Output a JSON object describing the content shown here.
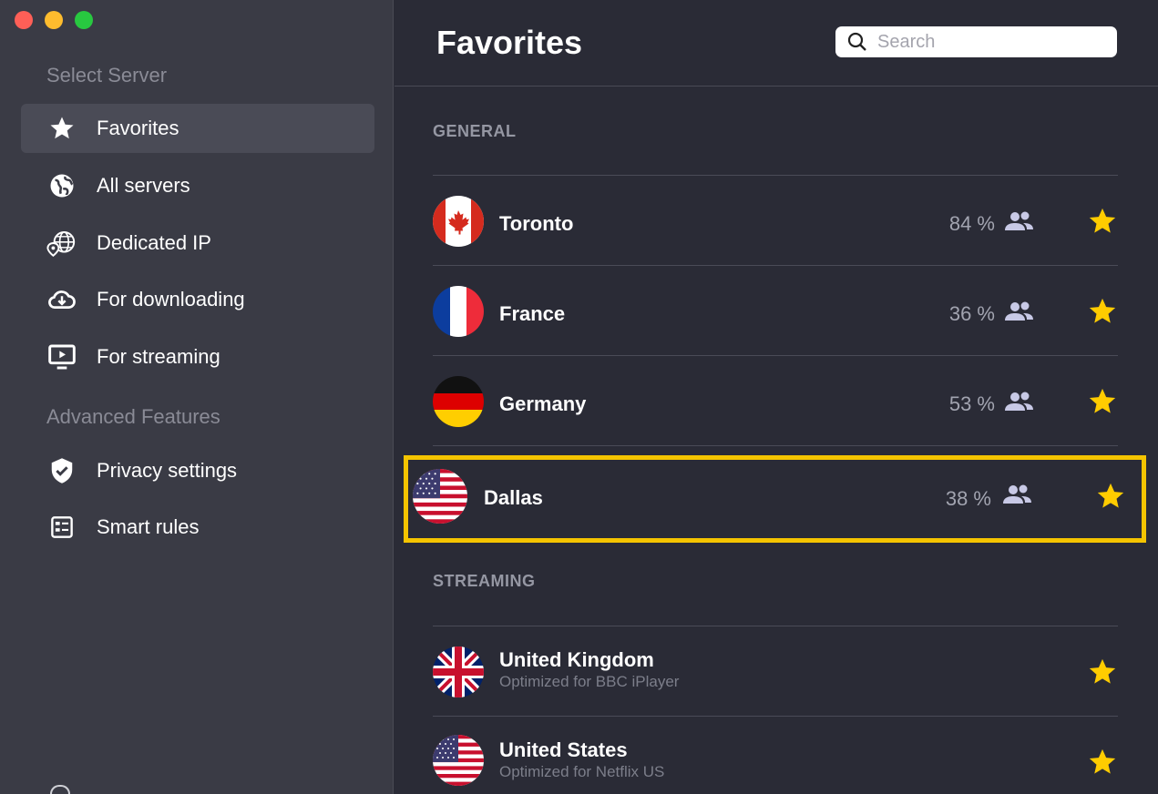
{
  "sidebar": {
    "select_server_heading": "Select Server",
    "items": [
      {
        "label": "Favorites",
        "icon": "star-icon",
        "active": true
      },
      {
        "label": "All servers",
        "icon": "globe-icon"
      },
      {
        "label": "Dedicated IP",
        "icon": "dedicated-ip-globe-icon"
      },
      {
        "label": "For downloading",
        "icon": "cloud-download-icon"
      },
      {
        "label": "For streaming",
        "icon": "tv-play-icon"
      }
    ],
    "advanced_heading": "Advanced Features",
    "advanced_items": [
      {
        "label": "Privacy settings",
        "icon": "shield-check-icon"
      },
      {
        "label": "Smart rules",
        "icon": "rules-list-icon"
      }
    ]
  },
  "header": {
    "title": "Favorites",
    "search_placeholder": "Search"
  },
  "sections": {
    "general": {
      "label": "GENERAL",
      "servers": [
        {
          "name": "Toronto",
          "load": "84 %",
          "flag": "canada-flag-icon",
          "favorite": true
        },
        {
          "name": "France",
          "load": "36 %",
          "flag": "france-flag-icon",
          "favorite": true
        },
        {
          "name": "Germany",
          "load": "53 %",
          "flag": "germany-flag-icon",
          "favorite": true
        },
        {
          "name": "Dallas",
          "load": "38 %",
          "flag": "usa-flag-icon",
          "favorite": true,
          "highlighted": true
        }
      ]
    },
    "streaming": {
      "label": "STREAMING",
      "servers": [
        {
          "name": "United Kingdom",
          "subtitle": "Optimized for BBC iPlayer",
          "flag": "uk-flag-icon",
          "favorite": true
        },
        {
          "name": "United States",
          "subtitle": "Optimized for Netflix US",
          "flag": "usa-flag-icon",
          "favorite": true
        }
      ]
    }
  },
  "colors": {
    "star": "#ffcc00",
    "highlight_border": "#f5c400",
    "sidebar_bg": "#3a3b45",
    "main_bg": "#2a2b36"
  }
}
